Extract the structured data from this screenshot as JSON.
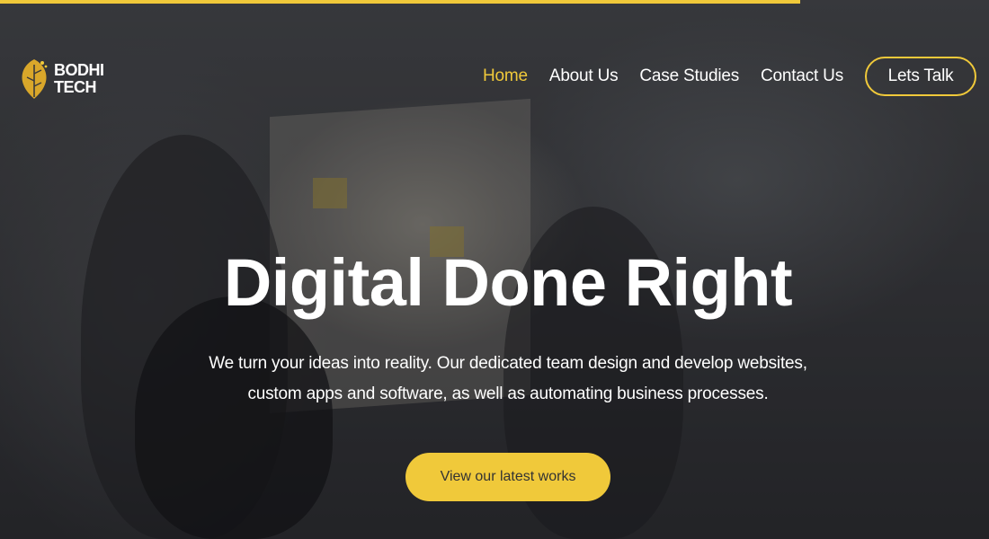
{
  "brand": {
    "line1": "BODHI",
    "line2": "TECH",
    "logo_icon": "leaf-logo-icon",
    "accent_color": "#f0c93a"
  },
  "nav": {
    "items": [
      {
        "label": "Home",
        "active": true
      },
      {
        "label": "About Us",
        "active": false
      },
      {
        "label": "Case Studies",
        "active": false
      },
      {
        "label": "Contact Us",
        "active": false
      }
    ],
    "cta_label": "Lets Talk"
  },
  "hero": {
    "title": "Digital Done Right",
    "subtitle_line1": "We turn your ideas into reality. Our dedicated team design and develop websites,",
    "subtitle_line2": "custom apps and software, as well as automating business processes.",
    "button_label": "View our latest works"
  }
}
